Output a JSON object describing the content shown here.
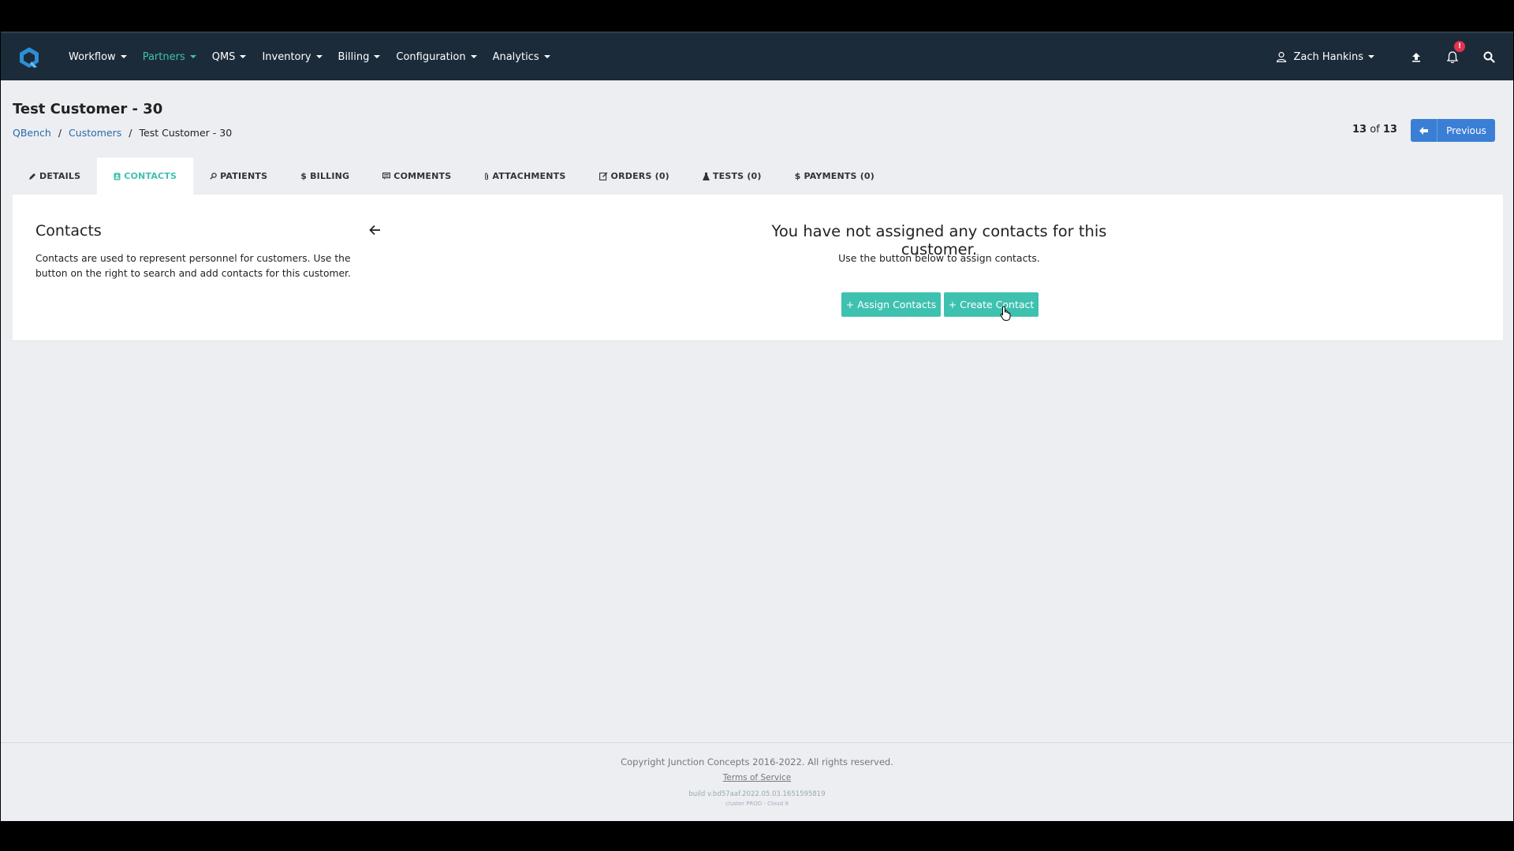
{
  "nav": {
    "items": [
      {
        "label": "Workflow",
        "active": false
      },
      {
        "label": "Partners",
        "active": true
      },
      {
        "label": "QMS",
        "active": false
      },
      {
        "label": "Inventory",
        "active": false
      },
      {
        "label": "Billing",
        "active": false
      },
      {
        "label": "Configuration",
        "active": false
      },
      {
        "label": "Analytics",
        "active": false
      }
    ],
    "user_name": "Zach Hankins",
    "notification_badge": "!"
  },
  "header": {
    "title": "Test Customer - 30",
    "breadcrumb": [
      "QBench",
      "Customers",
      "Test Customer - 30"
    ],
    "counter_current": "13",
    "counter_of": " of ",
    "counter_total": "13",
    "previous_label": "Previous"
  },
  "tabs": [
    {
      "label": "DETAILS",
      "icon": "pencil-icon",
      "active": false
    },
    {
      "label": "CONTACTS",
      "icon": "contact-book-icon",
      "active": true
    },
    {
      "label": "PATIENTS",
      "icon": "pin-icon",
      "active": false
    },
    {
      "label": "BILLING",
      "icon": "dollar-icon",
      "active": false
    },
    {
      "label": "COMMENTS",
      "icon": "comment-icon",
      "active": false
    },
    {
      "label": "ATTACHMENTS",
      "icon": "paperclip-icon",
      "active": false
    },
    {
      "label": "ORDERS (0)",
      "icon": "edit-icon",
      "active": false
    },
    {
      "label": "TESTS (0)",
      "icon": "flask-icon",
      "active": false
    },
    {
      "label": "PAYMENTS (0)",
      "icon": "dollar-icon",
      "active": false
    }
  ],
  "contacts": {
    "title": "Contacts",
    "description": "Contacts are used to represent personnel for customers. Use the button on the right to search and add contacts for this customer.",
    "empty_title": "You have not assigned any contacts for this customer.",
    "empty_subtitle": "Use the button below to assign contacts.",
    "assign_label": "+ Assign Contacts",
    "create_label": "+ Create Contact"
  },
  "footer": {
    "copyright": "Copyright Junction Concepts 2016-2022. All rights reserved.",
    "terms": "Terms of Service",
    "build": "build v.bd57aaf.2022.05.03.1651595819",
    "cluster": "cluster PROD - Cloud 9"
  },
  "colors": {
    "navbar": "#1c2b3a",
    "accent": "#3fc1b0",
    "link": "#2b6aa5",
    "primary_button": "#3a7fd5",
    "badge": "#e3334f"
  }
}
